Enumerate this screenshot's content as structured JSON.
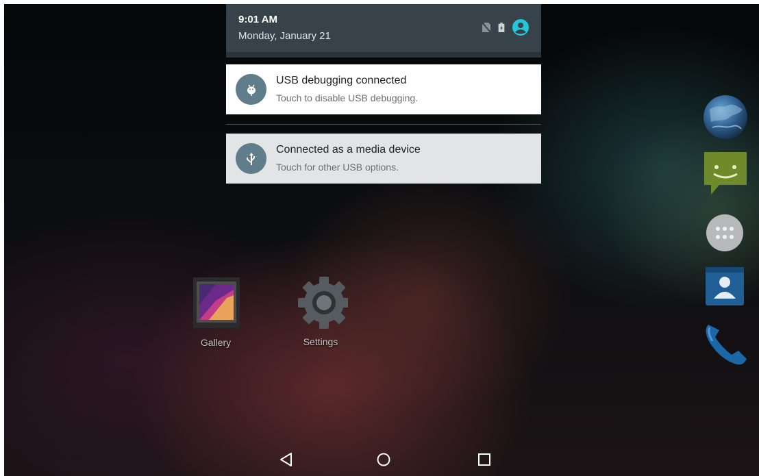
{
  "status_header": {
    "time": "9:01 AM",
    "date": "Monday, January 21",
    "icons": [
      "no-sim-icon",
      "battery-charging-icon",
      "account-avatar-icon"
    ],
    "accent": "#26c6da"
  },
  "notifications": [
    {
      "icon": "android-debug-icon",
      "title": "USB debugging connected",
      "text": "Touch to disable USB debugging."
    },
    {
      "icon": "usb-icon",
      "title": "Connected as a media device",
      "text": "Touch for other USB options."
    }
  ],
  "desktop_apps": [
    {
      "label": "Gallery",
      "icon": "gallery-icon"
    },
    {
      "label": "Settings",
      "icon": "settings-gear-icon"
    }
  ],
  "dock": [
    "browser-globe-icon",
    "messaging-icon",
    "app-drawer-icon",
    "contacts-icon",
    "phone-icon"
  ],
  "nav_bar": [
    "back-icon",
    "home-icon",
    "recents-icon"
  ],
  "colors": {
    "shade": "#37424a",
    "notif_badge": "#607d8b"
  }
}
